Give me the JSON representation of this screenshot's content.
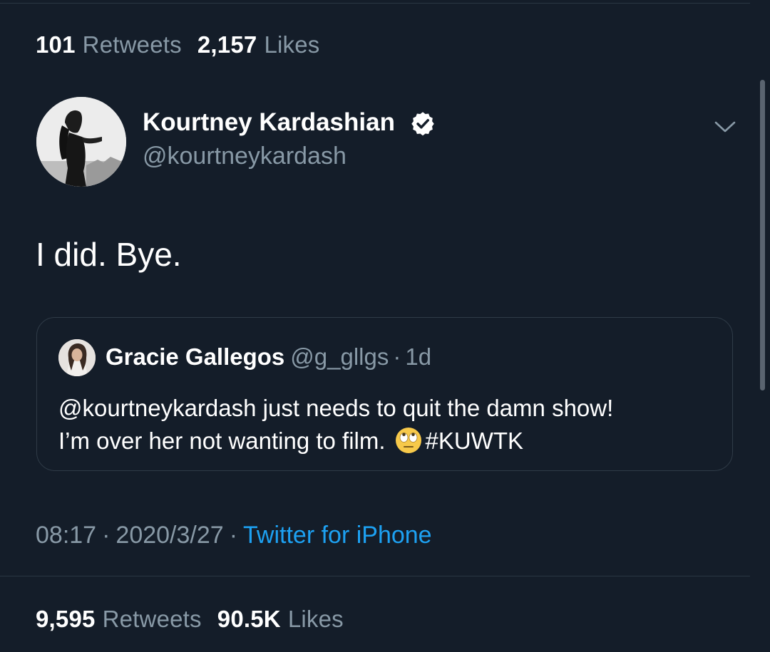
{
  "top_stats": {
    "retweets_count": "101",
    "retweets_label": "Retweets",
    "likes_count": "2,157",
    "likes_label": "Likes"
  },
  "tweet": {
    "author_name": "Kourtney Kardashian",
    "author_handle": "@kourtneykardash",
    "verified": true,
    "text": "I did. Bye.",
    "time": "08:17",
    "date": "2020/3/27",
    "source": "Twitter for iPhone",
    "separator": "·"
  },
  "quoted_tweet": {
    "author_name": "Gracie Gallegos",
    "author_handle": "@g_gllgs",
    "age": "1d",
    "separator": "·",
    "line1": "@kourtneykardash just needs to quit the damn show!",
    "line2": "I’m over her not wanting to film.",
    "emoji": "face-with-rolling-eyes",
    "hashtag": "#KUWTK"
  },
  "bottom_stats": {
    "retweets_count": "9,595",
    "retweets_label": "Retweets",
    "likes_count": "90.5K",
    "likes_label": "Likes"
  },
  "colors": {
    "background": "#141d29",
    "muted_text": "#8899a6",
    "link": "#1da1f2",
    "border": "#2f3b47"
  }
}
